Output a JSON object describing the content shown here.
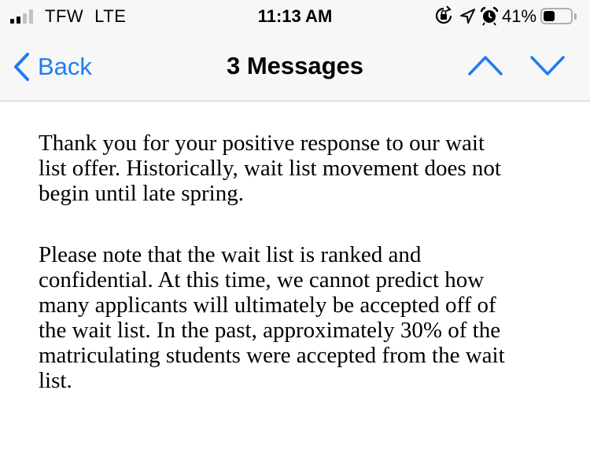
{
  "status_bar": {
    "carrier": "TFW",
    "network": "LTE",
    "time": "11:13 AM",
    "battery_percent": "41%",
    "battery_level": 0.41,
    "signal_bars_filled": 2,
    "signal_bars_total": 4,
    "icons": [
      "screen-rotation-lock-icon",
      "location-arrow-icon",
      "alarm-clock-icon"
    ]
  },
  "nav": {
    "back_label": "Back",
    "title": "3 Messages"
  },
  "message": {
    "paragraphs": [
      "Thank you for your positive response to our wait\nlist offer. Historically, wait list movement does not\nbegin until late spring.",
      "Please note that the wait list is ranked and\nconfidential.  At this time, we cannot predict how\nmany applicants will ultimately be accepted off of\nthe wait list. In the past, approximately 30% of the\nmatriculating students were accepted from the wait\nlist."
    ]
  },
  "colors": {
    "accent": "#1d7df3",
    "nav_background": "#f7f7f7",
    "text": "#000000",
    "signal_inactive": "#c2c2c2"
  }
}
